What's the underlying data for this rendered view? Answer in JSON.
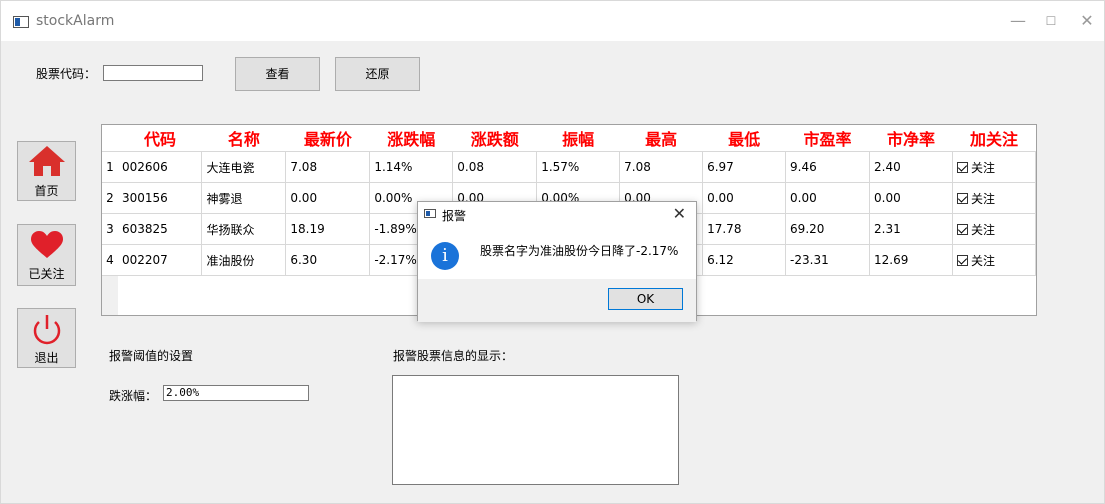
{
  "window": {
    "title": "stockAlarm",
    "minimize": "—",
    "maximize": "☐",
    "close": "✕"
  },
  "search": {
    "label": "股票代码：",
    "value": "",
    "view_button": "查看",
    "restore_button": "还原"
  },
  "nav": {
    "home": "首页",
    "favorites": "已关注",
    "exit": "退出"
  },
  "table": {
    "headers": [
      "代码",
      "名称",
      "最新价",
      "涨跌幅",
      "涨跌额",
      "振幅",
      "最高",
      "最低",
      "市盈率",
      "市净率",
      "加关注"
    ],
    "rows": [
      {
        "num": "1",
        "code": "002606",
        "name": "大连电瓷",
        "price": "7.08",
        "pct": "1.14%",
        "amt": "0.08",
        "amp": "1.57%",
        "high": "7.08",
        "low": "6.97",
        "pe": "9.46",
        "pb": "2.40",
        "follow": "关注"
      },
      {
        "num": "2",
        "code": "300156",
        "name": "神雾退",
        "price": "0.00",
        "pct": "0.00%",
        "amt": "0.00",
        "amp": "0.00%",
        "high": "0.00",
        "low": "0.00",
        "pe": "0.00",
        "pb": "0.00",
        "follow": "关注"
      },
      {
        "num": "3",
        "code": "603825",
        "name": "华扬联众",
        "price": "18.19",
        "pct": "-1.89%",
        "amt": "",
        "amp": "",
        "high": "",
        "low": "17.78",
        "pe": "69.20",
        "pb": "2.31",
        "follow": "关注"
      },
      {
        "num": "4",
        "code": "002207",
        "name": "准油股份",
        "price": "6.30",
        "pct": "-2.17%",
        "amt": "",
        "amp": "",
        "high": "",
        "low": "6.12",
        "pe": "-23.31",
        "pb": "12.69",
        "follow": "关注"
      }
    ]
  },
  "threshold": {
    "section_label": "报警阈值的设置",
    "field_label": "跌涨幅：",
    "value": "2.00%"
  },
  "info_display": {
    "label": "报警股票信息的显示："
  },
  "dialog": {
    "title": "报警",
    "message": "股票名字为准油股份今日降了-2.17%",
    "ok": "OK",
    "close": "✕",
    "info_glyph": "i"
  },
  "colors": {
    "header_red": "#ff0000",
    "home_red": "#d9302c",
    "heart_red": "#e0202a",
    "info_blue": "#1a73d9"
  }
}
